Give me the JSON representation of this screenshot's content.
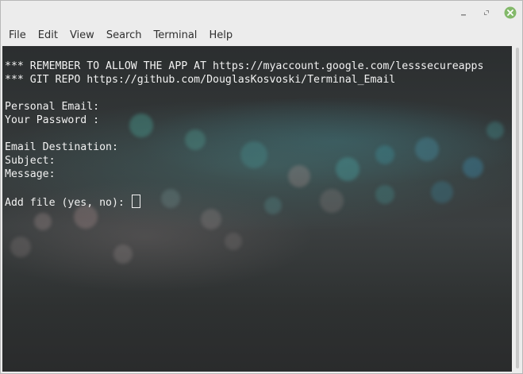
{
  "window": {
    "controls": {
      "minimize_icon": "minimize-icon",
      "maximize_icon": "maximize-icon",
      "close_icon": "close-icon",
      "close_color": "#83b96a"
    }
  },
  "menubar": {
    "items": [
      {
        "label": "File"
      },
      {
        "label": "Edit"
      },
      {
        "label": "View"
      },
      {
        "label": "Search"
      },
      {
        "label": "Terminal"
      },
      {
        "label": "Help"
      }
    ]
  },
  "terminal": {
    "text_color": "#f2f2f2",
    "lines": [
      "*** REMEMBER TO ALLOW THE APP AT https://myaccount.google.com/lesssecureapps",
      "*** GIT REPO https://github.com/DouglasKosvoski/Terminal_Email",
      "",
      "Personal Email:",
      "Your Password :",
      "",
      "Email Destination:",
      "Subject:",
      "Message:",
      "",
      "Add file (yes, no): "
    ]
  }
}
